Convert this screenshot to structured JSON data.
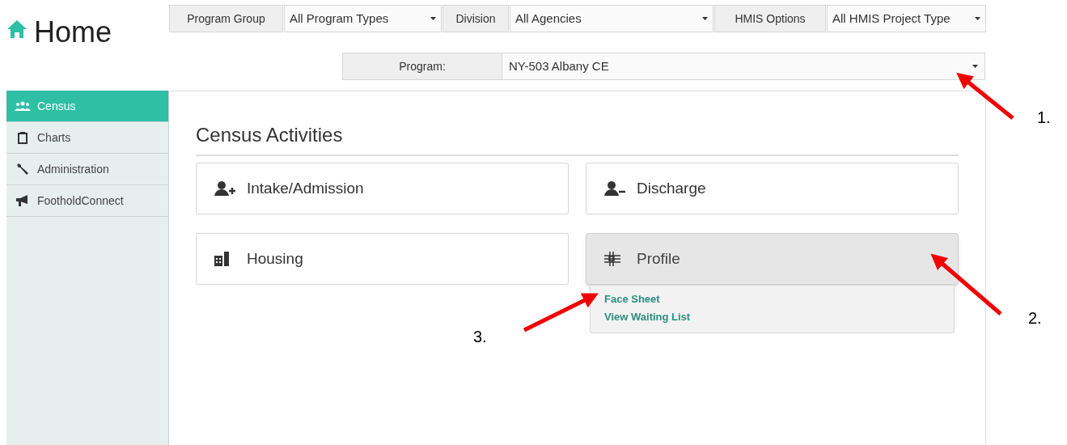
{
  "header": {
    "title": "Home"
  },
  "filters": [
    {
      "label": "Program Group",
      "value": "All Program Types"
    },
    {
      "label": "Division",
      "value": "All Agencies"
    },
    {
      "label": "HMIS Options",
      "value": "All HMIS Project Type"
    }
  ],
  "program": {
    "label": "Program:",
    "value": "NY-503 Albany CE"
  },
  "sidebar": {
    "items": [
      {
        "label": "Census",
        "kind": "people",
        "selected": true
      },
      {
        "label": "Charts",
        "kind": "clipboard",
        "selected": false
      },
      {
        "label": "Administration",
        "kind": "wrench",
        "selected": false
      },
      {
        "label": "FootholdConnect",
        "kind": "megaphone",
        "selected": false
      }
    ]
  },
  "section_title": "Census Activities",
  "tiles": [
    {
      "label": "Intake/Admission",
      "kind": "user-plus",
      "expanded": false
    },
    {
      "label": "Discharge",
      "kind": "user-minus",
      "expanded": false
    },
    {
      "label": "Housing",
      "kind": "building",
      "expanded": false
    },
    {
      "label": "Profile",
      "kind": "profile",
      "expanded": true,
      "menu": [
        "Face Sheet",
        "View Waiting List"
      ]
    }
  ],
  "annotations": [
    {
      "label": "1."
    },
    {
      "label": "2."
    },
    {
      "label": "3."
    }
  ]
}
